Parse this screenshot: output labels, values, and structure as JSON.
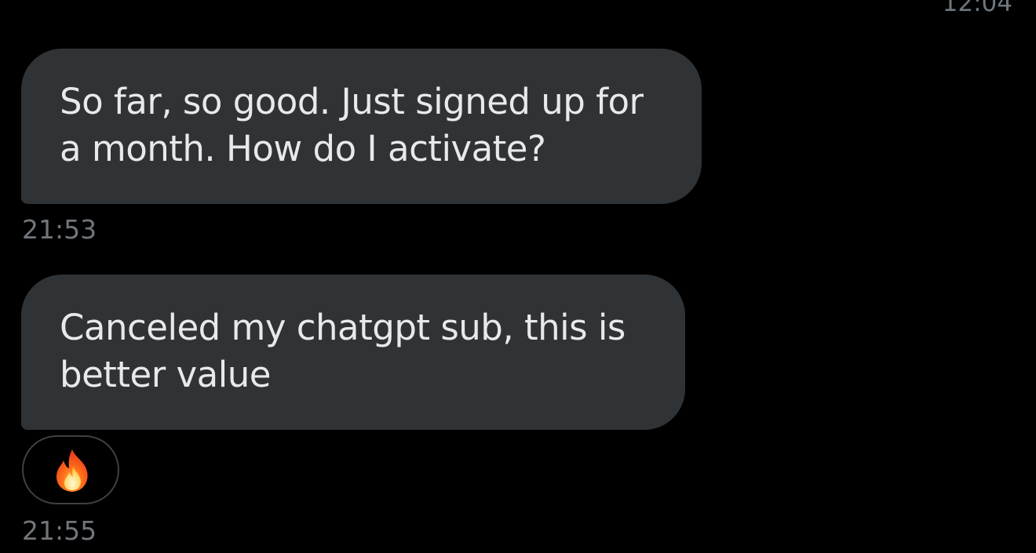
{
  "top_timestamp": "12:04",
  "messages": [
    {
      "text_line1": "So far, so good. Just signed up for",
      "text_line2": "a month. How do I activate?",
      "time": "21:53"
    },
    {
      "text_line1": "Canceled my chatgpt sub, this is",
      "text_line2": "better value",
      "time": "21:55",
      "reaction": "fire-icon"
    }
  ],
  "colors": {
    "background": "#000000",
    "bubble": "#2f3336",
    "text": "#e7e9ea",
    "timestamp": "#71767b"
  }
}
